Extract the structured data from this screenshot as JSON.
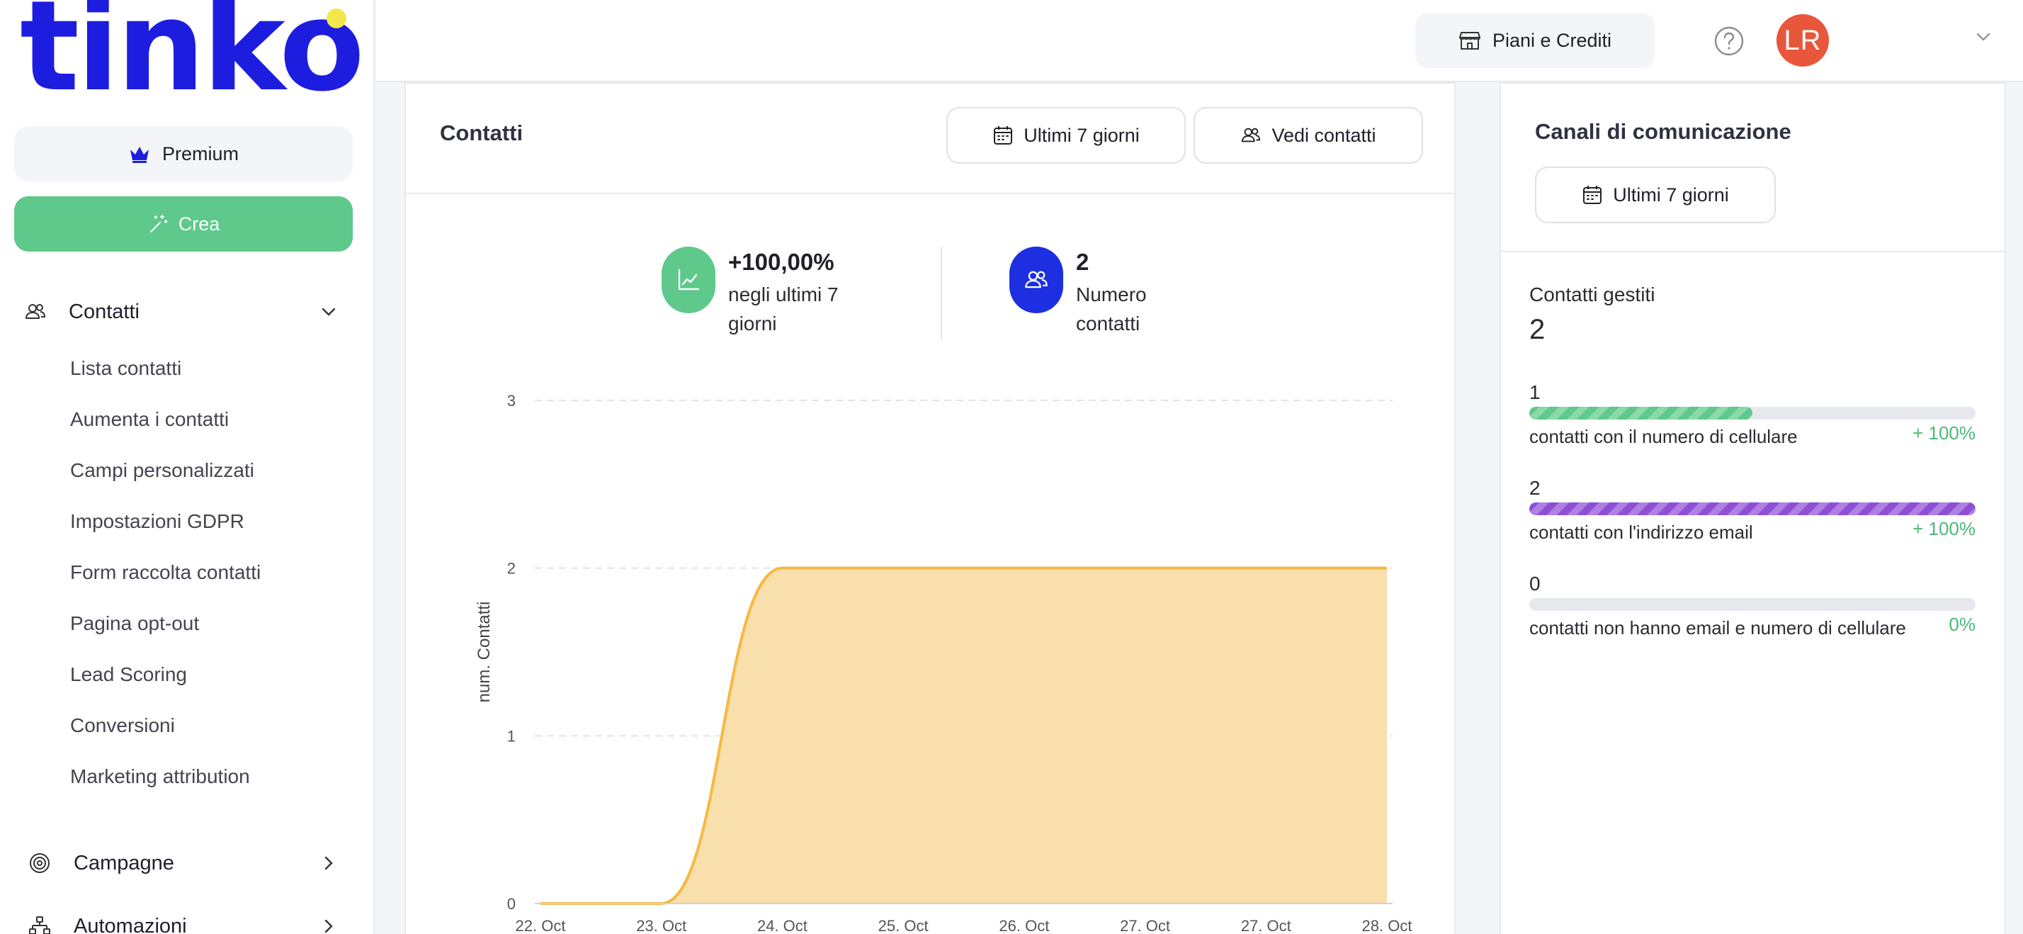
{
  "sidebar": {
    "logo": "tinko",
    "premium_label": "Premium",
    "create_label": "Crea",
    "groups": [
      {
        "label": "Contatti",
        "icon": "users-icon",
        "expanded": true
      },
      {
        "label": "Campagne",
        "icon": "target-icon",
        "expanded": false
      },
      {
        "label": "Automazioni",
        "icon": "workflow-icon",
        "expanded": false
      }
    ],
    "contact_items": [
      "Lista contatti",
      "Aumenta i contatti",
      "Campi personalizzati",
      "Impostazioni GDPR",
      "Form raccolta contatti",
      "Pagina opt-out",
      "Lead Scoring",
      "Conversioni",
      "Marketing attribution"
    ]
  },
  "topbar": {
    "plans_label": "Piani e Crediti",
    "avatar_initials": "LR"
  },
  "contacts_card": {
    "title": "Contatti",
    "period_button": "Ultimi 7 giorni",
    "view_button": "Vedi contatti",
    "growth_value": "+100,00%",
    "growth_caption": "negli ultimi 7 giorni",
    "count_value": "2",
    "count_caption": "Numero contatti"
  },
  "chart_data": {
    "type": "area",
    "ylabel": "num. Contatti",
    "x": [
      "22. Oct",
      "23. Oct",
      "24. Oct",
      "25. Oct",
      "26. Oct",
      "27. Oct",
      "27. Oct",
      "28. Oct"
    ],
    "y_ticks": [
      "0",
      "1",
      "2",
      "3"
    ],
    "ylim": [
      0,
      3
    ],
    "series": [
      {
        "values": [
          0,
          0,
          2,
          2,
          2,
          2,
          2,
          2
        ]
      }
    ],
    "grid": true,
    "colors": {
      "line": "#f5b942",
      "fill": "#f8dfab"
    }
  },
  "channels_card": {
    "title": "Canali di comunicazione",
    "period_button": "Ultimi 7 giorni",
    "managed_label": "Contatti gestiti",
    "managed_value": "2",
    "metrics": [
      {
        "value": "1",
        "label": "contatti con il numero di cellulare",
        "percent": "+ 100%",
        "fill_fraction": 0.5,
        "color": "#5ec98a"
      },
      {
        "value": "2",
        "label": "contatti con l'indirizzo email",
        "percent": "+ 100%",
        "fill_fraction": 1.0,
        "color": "#8e4fd6"
      },
      {
        "value": "0",
        "label": "contatti non hanno email e numero di cellulare",
        "percent": "0%",
        "fill_fraction": 0,
        "color": "#5ec98a"
      }
    ]
  }
}
